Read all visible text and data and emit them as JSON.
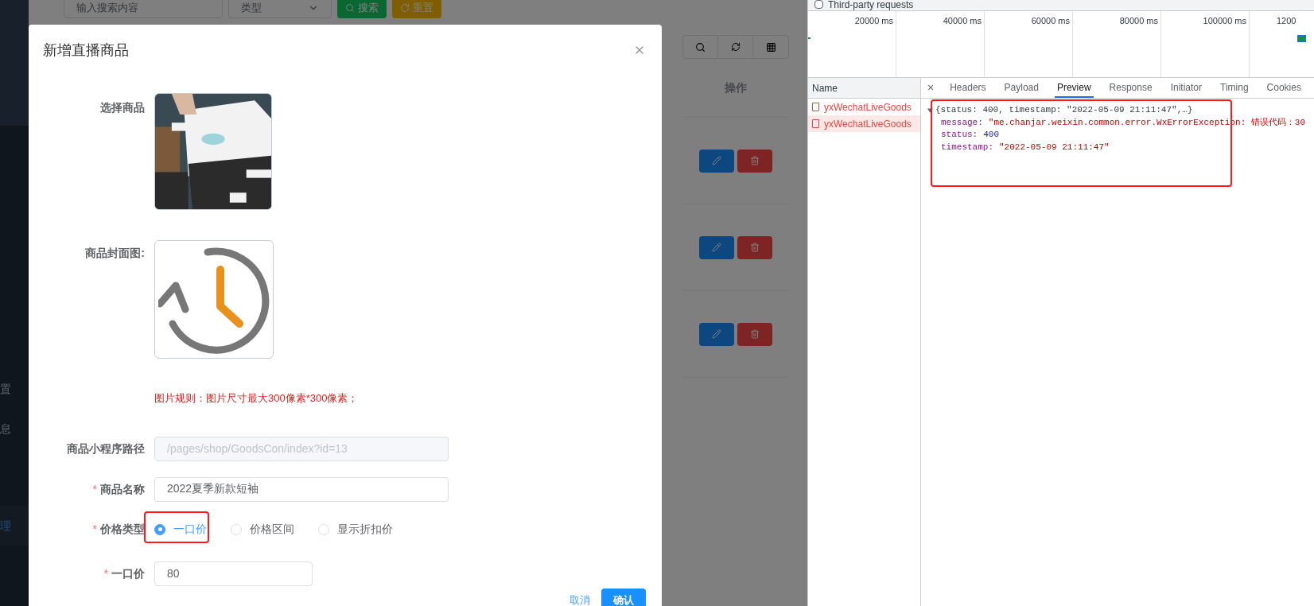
{
  "sidebar": {
    "items": [
      {
        "label": "置",
        "selected": false
      },
      {
        "label": "息",
        "selected": false
      },
      {
        "label": "理",
        "selected": true
      }
    ]
  },
  "toolbar": {
    "search_placeholder": "输入搜索内容",
    "type_placeholder": "类型",
    "search_button": "搜索",
    "reset_button": "重置"
  },
  "table": {
    "columns": [
      "操作"
    ],
    "rows": [
      {
        "kind": "actions"
      },
      {
        "kind": "actions"
      },
      {
        "kind": "actions"
      }
    ]
  },
  "dialog": {
    "title": "新增直播商品",
    "fields": [
      {
        "label": "选择商品"
      },
      {
        "kind": "cover",
        "label": "商品封面图:"
      },
      {
        "kind": "hint",
        "text": "图片规则：图片尺寸最大300像素*300像素；"
      },
      {
        "kind": "input",
        "label": "商品小程序路径",
        "value": "/pages/shop/GoodsCon/index?id=13",
        "disabled": true
      },
      {
        "kind": "input",
        "label": "商品名称",
        "mark": "*",
        "value": "2022夏季新款短袖",
        "disabled": false
      },
      {
        "kind": "radio",
        "label": "价格类型",
        "mark": "*",
        "options": [
          {
            "label": "一口价",
            "selected": true
          },
          {
            "label": "价格区间",
            "selected": false
          },
          {
            "label": "显示折扣价",
            "selected": false
          }
        ]
      },
      {
        "kind": "price",
        "label": "一口价",
        "mark": "*",
        "value": "80",
        "disabled": false
      }
    ],
    "cancel_button": "取消",
    "confirm_button": "确认"
  },
  "devtools": {
    "filter": {
      "label": "Third-party requests",
      "checked": false
    },
    "timeline_ticks": [
      "20000 ms",
      "40000 ms",
      "60000 ms",
      "80000 ms",
      "100000 ms",
      "1200"
    ],
    "name_header": "Name",
    "requests": [
      {
        "name": "yxWechatLiveGoods",
        "selected": false
      },
      {
        "name": "yxWechatLiveGoods",
        "selected": true
      }
    ],
    "close_label": "×",
    "tabs": [
      {
        "label": "Headers",
        "selected": false
      },
      {
        "label": "Payload",
        "selected": false
      },
      {
        "label": "Preview",
        "selected": true
      },
      {
        "label": "Response",
        "selected": false
      },
      {
        "label": "Initiator",
        "selected": false
      },
      {
        "label": "Timing",
        "selected": false
      },
      {
        "label": "Cookies",
        "selected": false
      }
    ],
    "preview": {
      "summary": "{status: 400, timestamp: \"2022-05-09 21:11:47\",…}",
      "fields": [
        {
          "key": "message:",
          "value": "\"me.chanjar.weixin.common.error.WxErrorException: 错误代码：30",
          "kind": "string"
        },
        {
          "key": "status:",
          "value": "400",
          "kind": "number"
        },
        {
          "key": "timestamp:",
          "value": "\"2022-05-09 21:11:47\"",
          "kind": "string"
        }
      ]
    }
  }
}
